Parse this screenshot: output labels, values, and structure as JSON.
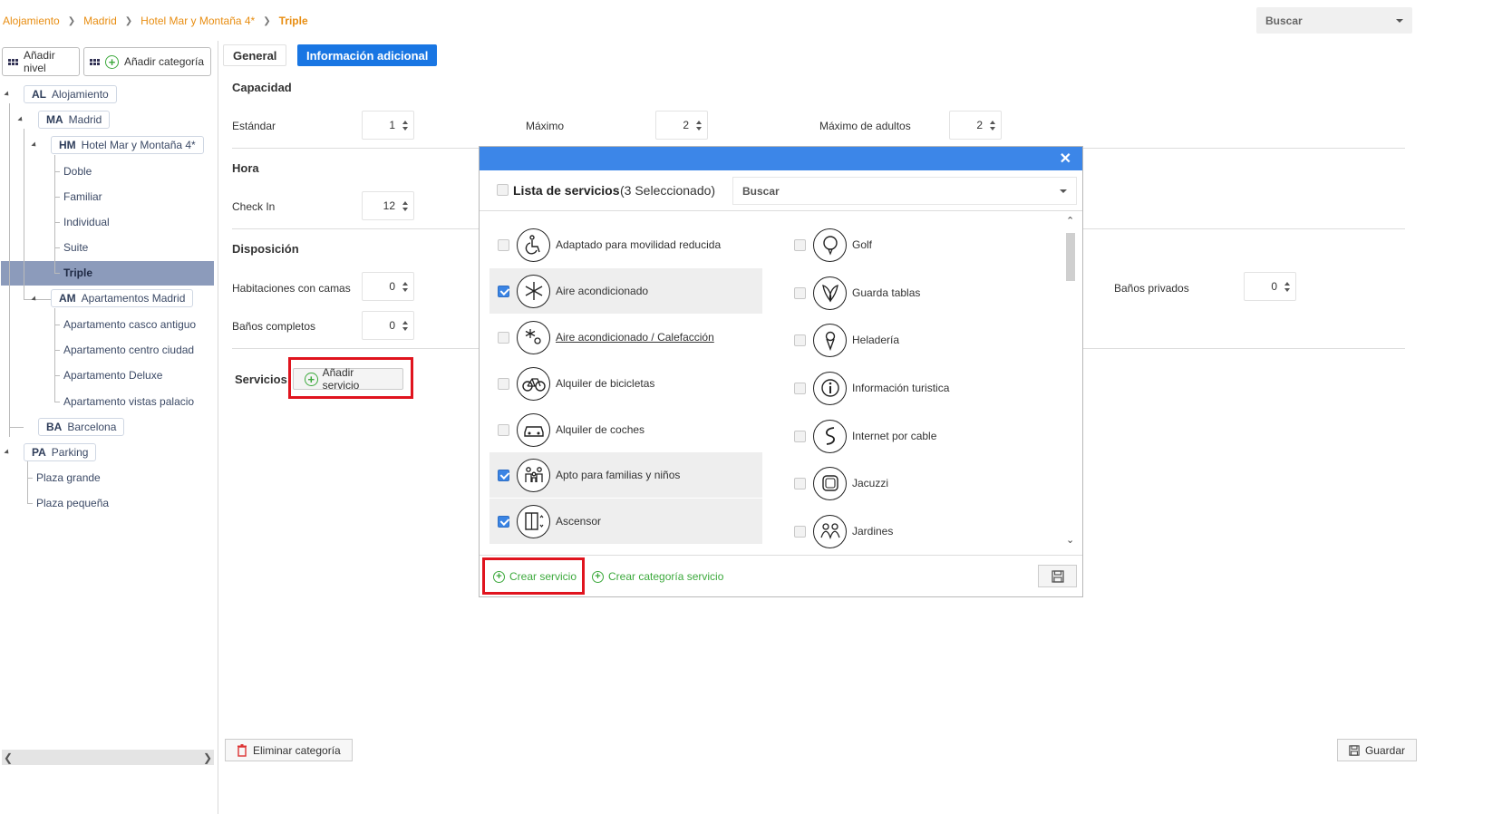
{
  "breadcrumb": [
    "Alojamiento",
    "Madrid",
    "Hotel Mar y Montaña 4*",
    "Triple"
  ],
  "top_search": {
    "placeholder": "Buscar"
  },
  "left": {
    "add_level": "Añadir nivel",
    "add_category": "Añadir categoría",
    "tree": {
      "al": {
        "code": "AL",
        "label": "Alojamiento"
      },
      "ma": {
        "code": "MA",
        "label": "Madrid"
      },
      "hm": {
        "code": "HM",
        "label": "Hotel Mar y Montaña 4*"
      },
      "hm_rooms": [
        "Doble",
        "Familiar",
        "Individual",
        "Suite",
        "Triple"
      ],
      "am": {
        "code": "AM",
        "label": "Apartamentos Madrid"
      },
      "am_rooms": [
        "Apartamento casco antiguo",
        "Apartamento centro ciudad",
        "Apartamento Deluxe",
        "Apartamento vistas palacio"
      ],
      "ba": {
        "code": "BA",
        "label": "Barcelona"
      },
      "pa": {
        "code": "PA",
        "label": "Parking"
      },
      "pa_items": [
        "Plaza grande",
        "Plaza pequeña"
      ]
    }
  },
  "tabs": {
    "general": "General",
    "info": "Información adicional"
  },
  "capacidad": {
    "title": "Capacidad",
    "estandar_label": "Estándar",
    "estandar_value": "1",
    "maximo_label": "Máximo",
    "maximo_value": "2",
    "max_adultos_label": "Máximo de adultos",
    "max_adultos_value": "2"
  },
  "hora": {
    "title": "Hora",
    "checkin_label": "Check In",
    "checkin_value": "12"
  },
  "disposicion": {
    "title": "Disposición",
    "hab_camas_label": "Habitaciones con camas",
    "hab_camas_value": "0",
    "banos_completos_label": "Baños completos",
    "banos_completos_value": "0",
    "banos_privados_label": "Baños privados",
    "banos_privados_value": "0"
  },
  "servicios": {
    "title": "Servicios",
    "add_button": "Añadir servicio"
  },
  "bottom": {
    "delete_category": "Eliminar categoría",
    "save": "Guardar"
  },
  "modal": {
    "title": "Lista de servicios",
    "selected_count": "(3 Seleccionado)",
    "search_placeholder": "Buscar",
    "services_left": [
      {
        "label": "Adaptado para movilidad reducida",
        "checked": false,
        "icon": "wheelchair-icon"
      },
      {
        "label": "Aire acondicionado",
        "checked": true,
        "icon": "snowflake-icon"
      },
      {
        "label": "Aire acondicionado / Calefacción",
        "checked": false,
        "icon": "snow-sun-icon"
      },
      {
        "label": "Alquiler de bicicletas",
        "checked": false,
        "icon": "bicycle-icon"
      },
      {
        "label": "Alquiler de coches",
        "checked": false,
        "icon": "car-icon"
      },
      {
        "label": "Apto para familias y niños",
        "checked": true,
        "icon": "family-icon"
      },
      {
        "label": "Ascensor",
        "checked": true,
        "icon": "elevator-icon"
      }
    ],
    "services_right": [
      {
        "label": "Golf",
        "checked": false,
        "icon": "golf-icon"
      },
      {
        "label": "Guarda tablas",
        "checked": false,
        "icon": "surfboard-icon"
      },
      {
        "label": "Heladería",
        "checked": false,
        "icon": "ice-cream-icon"
      },
      {
        "label": "Información turistica",
        "checked": false,
        "icon": "info-icon"
      },
      {
        "label": "Internet por cable",
        "checked": false,
        "icon": "cable-icon"
      },
      {
        "label": "Jacuzzi",
        "checked": false,
        "icon": "jacuzzi-icon"
      },
      {
        "label": "Jardines",
        "checked": false,
        "icon": "garden-icon"
      }
    ],
    "create_service": "Crear servicio",
    "create_category": "Crear categoría servicio"
  },
  "colors": {
    "accent": "#1976e3",
    "breadcrumb": "#e88e13",
    "green": "#3ca93c",
    "highlight_red": "#e0141e"
  }
}
